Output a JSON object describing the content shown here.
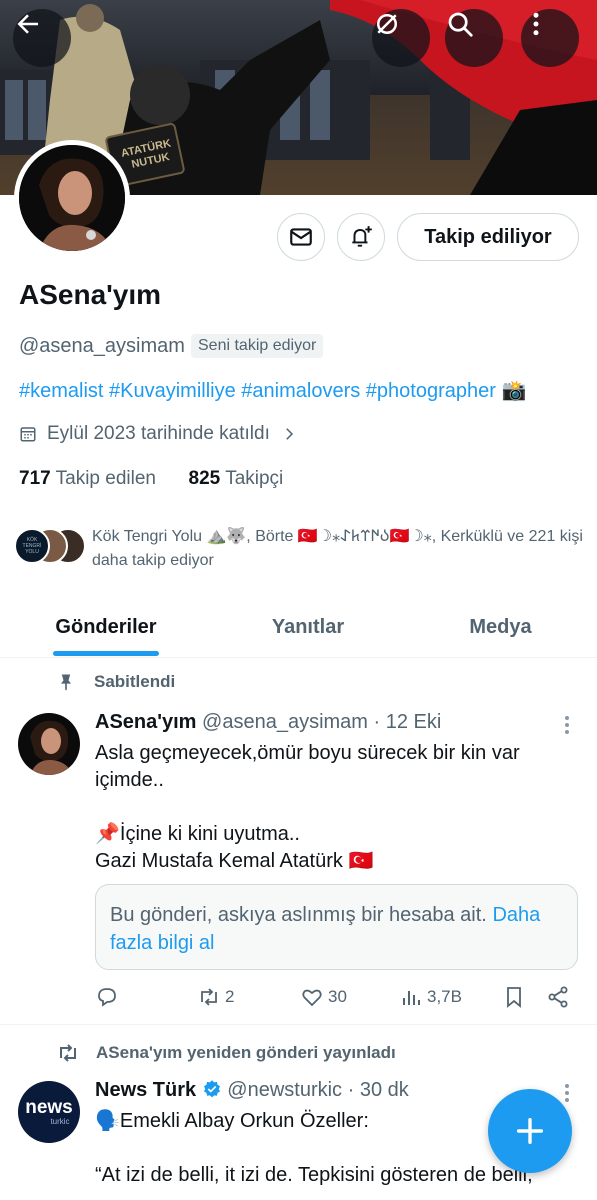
{
  "banner": {
    "sign_text_1": "ATATÜRK",
    "sign_text_2": "NUTUK"
  },
  "profile": {
    "name": "ASena'yım",
    "handle": "@asena_aysimam",
    "follows_you_badge": "Seni takip ediyor",
    "bio_hashtags": "#kemalist #Kuvayimilliye #animalovers #photographer",
    "bio_emoji": "📸",
    "joined": "Eylül 2023 tarihinde katıldı",
    "following_count": "717",
    "following_label": "Takip edilen",
    "followers_count": "825",
    "followers_label": "Takipçi",
    "mutuals_text": "Kök Tengri Yolu ⛰️🐺, Börte 🇹🇷☽⁎𐰉𐰇𐰼𐱅𐰀🇹🇷☽⁎, Kerküklü ve 221 kişi daha takip ediyor",
    "mutual_avatar_text": "KÖK TENGRİ YOLU"
  },
  "buttons": {
    "follow_state": "Takip ediliyor"
  },
  "tabs": [
    {
      "label": "Gönderiler",
      "active": true
    },
    {
      "label": "Yanıtlar",
      "active": false
    },
    {
      "label": "Medya",
      "active": false
    }
  ],
  "pinned_post": {
    "context_label": "Sabitlendi",
    "author_name": "ASena'yım",
    "author_handle": "@asena_aysimam",
    "time": "· 12 Eki",
    "lines": [
      "Asla geçmeyecek,ömür boyu sürecek bir kin var içimde..",
      "",
      "📌İçine ki kini uyutma..",
      "Gazi Mustafa Kemal Atatürk 🇹🇷"
    ],
    "notice_text": "Bu gönderi, askıya aslınmış bir hesaba ait.",
    "notice_link": "Daha fazla bilgi al",
    "reposts": "2",
    "likes": "30",
    "views": "3,7B"
  },
  "repost": {
    "context_label": "ASena'yım yeniden gönderi yayınladı",
    "author_name": "News Türk",
    "author_handle": "@newsturkic",
    "time": "· 30 dk",
    "avatar_text": "news",
    "avatar_subtext": "turkic",
    "line1": "🗣️Emekli Albay Orkun Özeller:",
    "line2": "“At izi de belli, it izi de. Tepkisini gösteren de belli,"
  },
  "icons": {
    "back": "arrow-left-icon",
    "grok": "grok-icon",
    "search": "search-icon",
    "more": "more-vertical-icon",
    "message": "envelope-icon",
    "notify": "bell-plus-icon",
    "calendar": "calendar-icon",
    "pin": "pin-icon",
    "reply": "reply-icon",
    "repost": "repost-icon",
    "like": "heart-icon",
    "views": "views-icon",
    "bookmark": "bookmark-icon",
    "share": "share-icon",
    "compose": "plus-icon"
  },
  "colors": {
    "accent": "#1d9bf0",
    "text": "#0f1419",
    "secondary": "#536471"
  }
}
